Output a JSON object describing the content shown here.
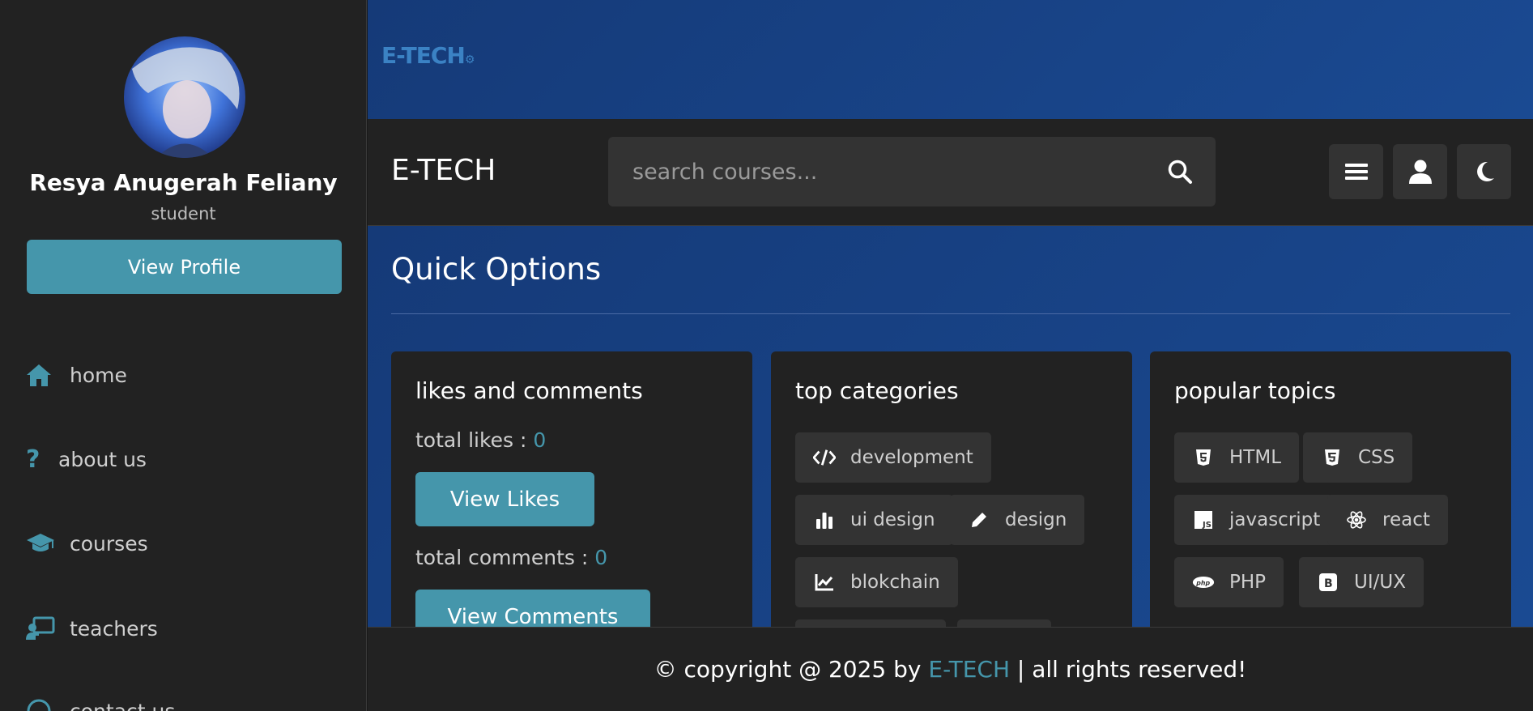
{
  "sidebar": {
    "profile": {
      "name": "Resya Anugerah Feliany",
      "role": "student",
      "button": "View Profile"
    },
    "nav": [
      {
        "label": "home",
        "icon": "home-icon"
      },
      {
        "label": "about us",
        "icon": "question-icon"
      },
      {
        "label": "courses",
        "icon": "graduation-cap-icon"
      },
      {
        "label": "teachers",
        "icon": "chalkboard-teacher-icon"
      },
      {
        "label": "contact us",
        "icon": "headset-icon"
      }
    ]
  },
  "banner": {
    "logo": "E-TECH"
  },
  "header": {
    "brand": "E-TECH",
    "search_placeholder": "search courses...",
    "buttons": [
      "menu-icon",
      "user-icon",
      "moon-icon"
    ]
  },
  "main": {
    "title": "Quick Options",
    "cards": {
      "likes": {
        "title": "likes and comments",
        "likes_label": "total likes : ",
        "likes_value": "0",
        "likes_button": "View Likes",
        "comments_label": "total comments : ",
        "comments_value": "0",
        "comments_button": "View Comments"
      },
      "categories": {
        "title": "top categories",
        "items": [
          {
            "label": "development",
            "icon": "code-icon"
          },
          {
            "label": "ui design",
            "icon": "bar-chart-icon"
          },
          {
            "label": "design",
            "icon": "pencil-icon"
          },
          {
            "label": "blokchain",
            "icon": "line-chart-icon"
          }
        ]
      },
      "topics": {
        "title": "popular topics",
        "items": [
          {
            "label": "HTML",
            "icon": "html5-icon"
          },
          {
            "label": "CSS",
            "icon": "css3-icon"
          },
          {
            "label": "javascript",
            "icon": "js-icon"
          },
          {
            "label": "react",
            "icon": "react-icon"
          },
          {
            "label": "PHP",
            "icon": "php-icon"
          },
          {
            "label": "UI/UX",
            "icon": "bootstrap-icon"
          }
        ]
      }
    }
  },
  "footer": {
    "prefix": "© copyright @ 2025 by ",
    "brand": "E-TECH",
    "suffix": " | all rights reserved!"
  },
  "colors": {
    "accent": "#4596ab",
    "panel": "#222222",
    "chip": "#333333",
    "banner": "#1a4a92"
  }
}
